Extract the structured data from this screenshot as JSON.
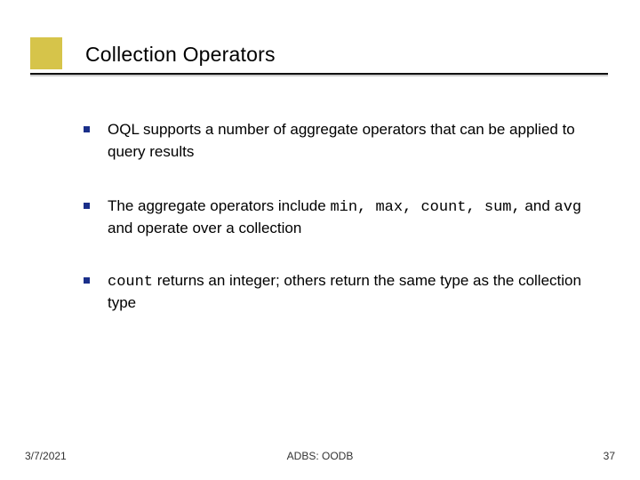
{
  "slide": {
    "title": "Collection Operators",
    "bullets": [
      {
        "pre": "",
        "code1": "",
        "mid": "OQL supports a number of aggregate operators that can be applied to query results",
        "code2": "",
        "post": ""
      },
      {
        "pre": "The aggregate operators include ",
        "code1": "min, max, count, sum,",
        "mid": " and ",
        "code2": "avg",
        "post": " and operate over a collection"
      },
      {
        "pre": "",
        "code1": "count",
        "mid": " returns an integer; others return the same type as the collection type",
        "code2": "",
        "post": ""
      }
    ],
    "footer": {
      "date": "3/7/2021",
      "center": "ADBS: OODB",
      "page": "37"
    }
  }
}
